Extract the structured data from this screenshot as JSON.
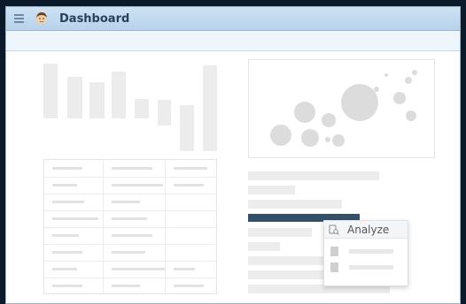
{
  "window": {
    "title": "Dashboard",
    "menu_icon": "hamburger-menu-icon",
    "avatar_icon": "user-avatar-icon"
  },
  "popup": {
    "label": "Analyze",
    "icon": "analyze-search-icon"
  },
  "colors": {
    "titlebar": "#c1d8ee",
    "title_text": "#27425a",
    "highlight_bar": "#344f68",
    "placeholder": "#ececec",
    "background": "#0a1a2b"
  }
}
